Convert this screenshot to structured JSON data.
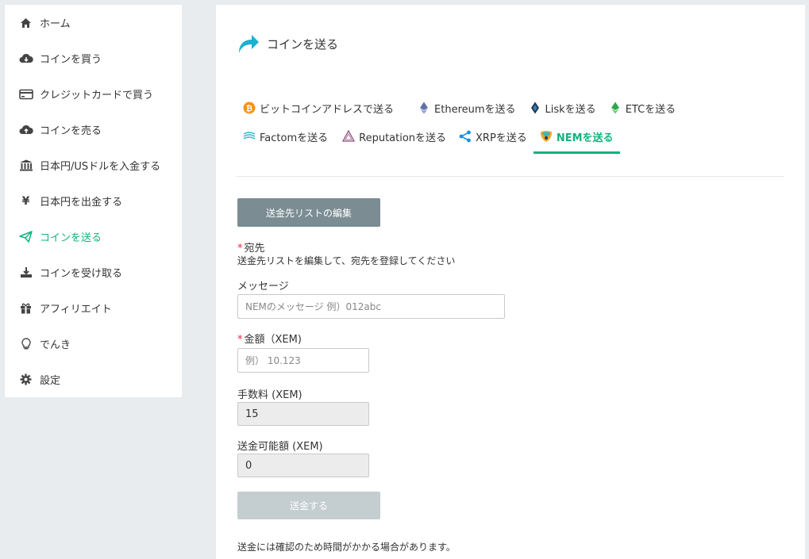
{
  "sidebar": {
    "items": [
      {
        "label": "ホーム",
        "icon": "home-icon"
      },
      {
        "label": "コインを買う",
        "icon": "cloud-download-icon"
      },
      {
        "label": "クレジットカードで買う",
        "icon": "credit-card-icon"
      },
      {
        "label": "コインを売る",
        "icon": "cloud-upload-icon"
      },
      {
        "label": "日本円/USドルを入金する",
        "icon": "bank-icon"
      },
      {
        "label": "日本円を出金する",
        "icon": "yen-icon"
      },
      {
        "label": "コインを送る",
        "icon": "paper-plane-icon",
        "active": true
      },
      {
        "label": "コインを受け取る",
        "icon": "download-tray-icon"
      },
      {
        "label": "アフィリエイト",
        "icon": "gift-icon"
      },
      {
        "label": "でんき",
        "icon": "lightbulb-icon"
      },
      {
        "label": "設定",
        "icon": "gear-icon"
      }
    ]
  },
  "header": {
    "title": "コインを送る",
    "icon": "share-arrow-icon"
  },
  "tabs": {
    "row1": [
      {
        "label": "ビットコインアドレスで送る",
        "icon": "bitcoin-icon"
      },
      {
        "label": "Ethereumを送る",
        "icon": "ethereum-icon"
      },
      {
        "label": "Liskを送る",
        "icon": "lisk-icon"
      },
      {
        "label": "ETCを送る",
        "icon": "etc-icon"
      }
    ],
    "row2": [
      {
        "label": "Factomを送る",
        "icon": "factom-icon"
      },
      {
        "label": "Reputationを送る",
        "icon": "reputation-icon"
      },
      {
        "label": "XRPを送る",
        "icon": "xrp-icon"
      },
      {
        "label": "NEMを送る",
        "icon": "nem-icon",
        "active": true
      }
    ]
  },
  "form": {
    "edit_list_button": "送金先リストの編集",
    "destination_label": "宛先",
    "destination_help": "送金先リストを編集して、宛先を登録してください",
    "message_label": "メッセージ",
    "message_placeholder": "NEMのメッセージ 例）012abc",
    "amount_label": "金額（XEM)",
    "amount_placeholder": "例） 10.123",
    "fee_label": "手数料 (XEM)",
    "fee_value": "15",
    "available_label": "送金可能額 (XEM)",
    "available_value": "0",
    "send_button": "送金する",
    "note": "送金には確認のため時間がかかる場合があります。"
  },
  "colors": {
    "accent": "#12b37c",
    "edit_button": "#7b8c93",
    "send_button_disabled": "#c4cdd0"
  }
}
